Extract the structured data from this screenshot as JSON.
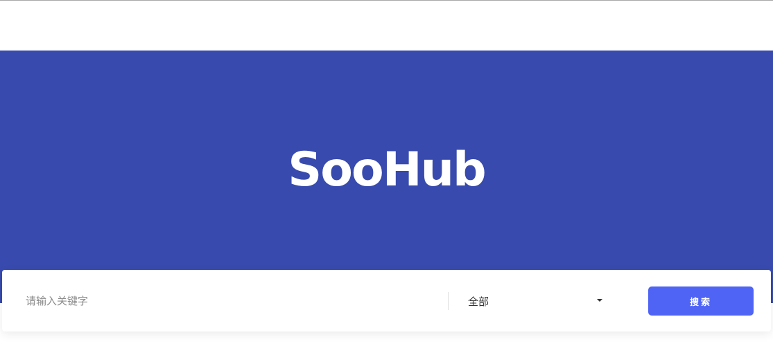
{
  "hero": {
    "title": "SooHub"
  },
  "search": {
    "placeholder": "请输入关键字",
    "value": "",
    "category": {
      "selected": "全部"
    },
    "button_label": "搜索"
  },
  "colors": {
    "hero_background": "#384aad",
    "button_background": "#4f64f5"
  }
}
